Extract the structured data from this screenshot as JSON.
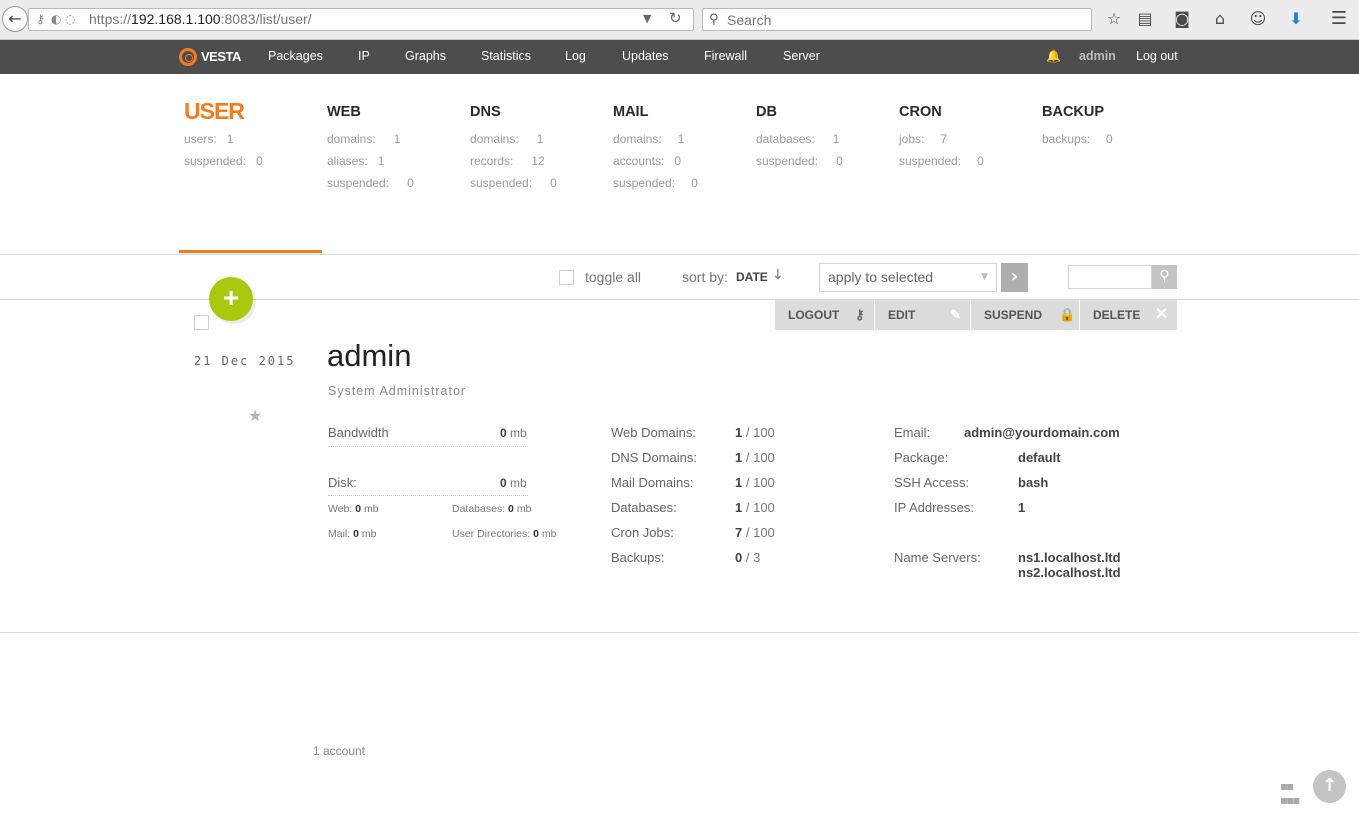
{
  "browser": {
    "url_scheme": "https://",
    "url_host": "192.168.1.100",
    "url_rest": ":8083/list/user/",
    "search_placeholder": "Search"
  },
  "nav": {
    "logo_text": "VESTA",
    "items": [
      "Packages",
      "IP",
      "Graphs",
      "Statistics",
      "Log",
      "Updates",
      "Firewall",
      "Server"
    ],
    "user": "admin",
    "logout": "Log out"
  },
  "stats": [
    {
      "title": "USER",
      "rows": [
        {
          "label": "users:",
          "value": "1"
        },
        {
          "label": "suspended:",
          "value": "0"
        }
      ]
    },
    {
      "title": "WEB",
      "rows": [
        {
          "label": "domains:",
          "value": "1"
        },
        {
          "label": "aliases:",
          "value": "1"
        },
        {
          "label": "suspended:",
          "value": "0"
        }
      ]
    },
    {
      "title": "DNS",
      "rows": [
        {
          "label": "domains:",
          "value": "1"
        },
        {
          "label": "records:",
          "value": "12"
        },
        {
          "label": "suspended:",
          "value": "0"
        }
      ]
    },
    {
      "title": "MAIL",
      "rows": [
        {
          "label": "domains:",
          "value": "1"
        },
        {
          "label": "accounts:",
          "value": "0"
        },
        {
          "label": "suspended:",
          "value": "0"
        }
      ]
    },
    {
      "title": "DB",
      "rows": [
        {
          "label": "databases:",
          "value": "1"
        },
        {
          "label": "suspended:",
          "value": "0"
        }
      ]
    },
    {
      "title": "CRON",
      "rows": [
        {
          "label": "jobs:",
          "value": "7"
        },
        {
          "label": "suspended:",
          "value": "0"
        }
      ]
    },
    {
      "title": "BACKUP",
      "rows": [
        {
          "label": "backups:",
          "value": "0"
        }
      ]
    }
  ],
  "toolbar": {
    "toggle_all": "toggle all",
    "sort_by": "sort by:",
    "sort_value": "DATE",
    "sort_arrow": "↓",
    "apply_selected": "apply to selected"
  },
  "actions": {
    "logout": "LOGOUT",
    "edit": "EDIT",
    "suspend": "SUSPEND",
    "delete": "DELETE"
  },
  "record": {
    "date": "21 Dec 2015",
    "username": "admin",
    "fullname": "System Administrator",
    "bandwidth_label": "Bandwidth",
    "bandwidth_value": "0",
    "disk_label": "Disk:",
    "disk_value": "0",
    "unit": "mb",
    "web_label": "Web:",
    "web_value": "0",
    "databases_label": "Databases:",
    "databases_value": "0",
    "mail_label": "Mail:",
    "mail_value": "0",
    "userdirs_label": "User Directories:",
    "userdirs_value": "0",
    "limits": [
      {
        "label": "Web Domains:",
        "used": "1",
        "max": "/ 100"
      },
      {
        "label": "DNS Domains:",
        "used": "1",
        "max": "/ 100"
      },
      {
        "label": "Mail Domains:",
        "used": "1",
        "max": "/ 100"
      },
      {
        "label": "Databases:",
        "used": "1",
        "max": "/ 100"
      },
      {
        "label": "Cron Jobs:",
        "used": "7",
        "max": "/ 100"
      },
      {
        "label": "Backups:",
        "used": "0",
        "max": "/ 3"
      }
    ],
    "email_label": "Email:",
    "email_value": "admin@yourdomain.com",
    "package_label": "Package:",
    "package_value": "default",
    "ssh_label": "SSH Access:",
    "ssh_value": "bash",
    "ip_label": "IP Addresses:",
    "ip_value": "1",
    "ns_label": "Name Servers:",
    "ns1": "ns1.localhost.ltd",
    "ns2": "ns2.localhost.ltd"
  },
  "footer": {
    "count": "1 account"
  }
}
